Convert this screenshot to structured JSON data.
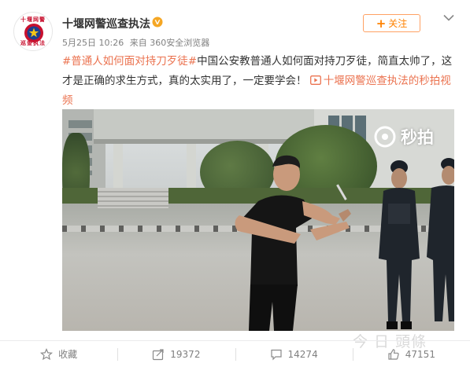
{
  "post": {
    "avatar": {
      "text_top": "十堰网警",
      "text_bottom": "巡查执法",
      "icon": "police-badge-icon"
    },
    "username": "十堰网警巡查执法",
    "verified_icon": "verified-v-icon",
    "date": "5月25日 10:26",
    "source": "来自 360安全浏览器",
    "follow_label": "关注",
    "text": {
      "hashtag": "#普通人如何面对持刀歹徒#",
      "body": "中国公安教普通人如何面对持刀歹徒，简直太帅了，这才是正确的求生方式，真的太实用了，一定要学会！",
      "video_link": "十堰网警巡查执法的秒拍视频",
      "video_link_icon": "video-play-icon"
    },
    "video": {
      "watermark": "秒拍",
      "watermark_icon": "miaopai-logo-icon"
    }
  },
  "actions": [
    {
      "name": "favorite",
      "icon": "star-icon",
      "label": "收藏"
    },
    {
      "name": "repost",
      "icon": "repost-icon",
      "label": "19372"
    },
    {
      "name": "comment",
      "icon": "comment-icon",
      "label": "14274"
    },
    {
      "name": "like",
      "icon": "thumbs-up-icon",
      "label": "47151"
    }
  ],
  "corner_watermark": "今 日 頭條",
  "colors": {
    "accent_orange": "#eb7350",
    "follow_orange": "#ff8200",
    "verified_gold": "#f5a623"
  }
}
